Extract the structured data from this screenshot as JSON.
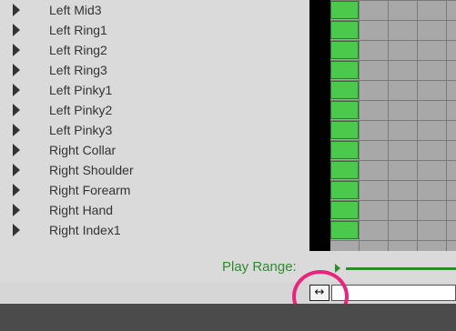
{
  "rows": [
    {
      "label": "Left Mid3"
    },
    {
      "label": "Left Ring1"
    },
    {
      "label": "Left Ring2"
    },
    {
      "label": "Left Ring3"
    },
    {
      "label": "Left Pinky1"
    },
    {
      "label": "Left Pinky2"
    },
    {
      "label": "Left Pinky3"
    },
    {
      "label": "Right Collar"
    },
    {
      "label": "Right Shoulder"
    },
    {
      "label": "Right Forearm"
    },
    {
      "label": "Right Hand"
    },
    {
      "label": "Right Index1"
    }
  ],
  "play_range": {
    "label": "Play Range:"
  },
  "resize_button": {
    "glyph": "↔"
  },
  "colors": {
    "keyframe": "#4cc84c",
    "play_range": "#2e8b2e",
    "highlight": "#e8247c"
  }
}
